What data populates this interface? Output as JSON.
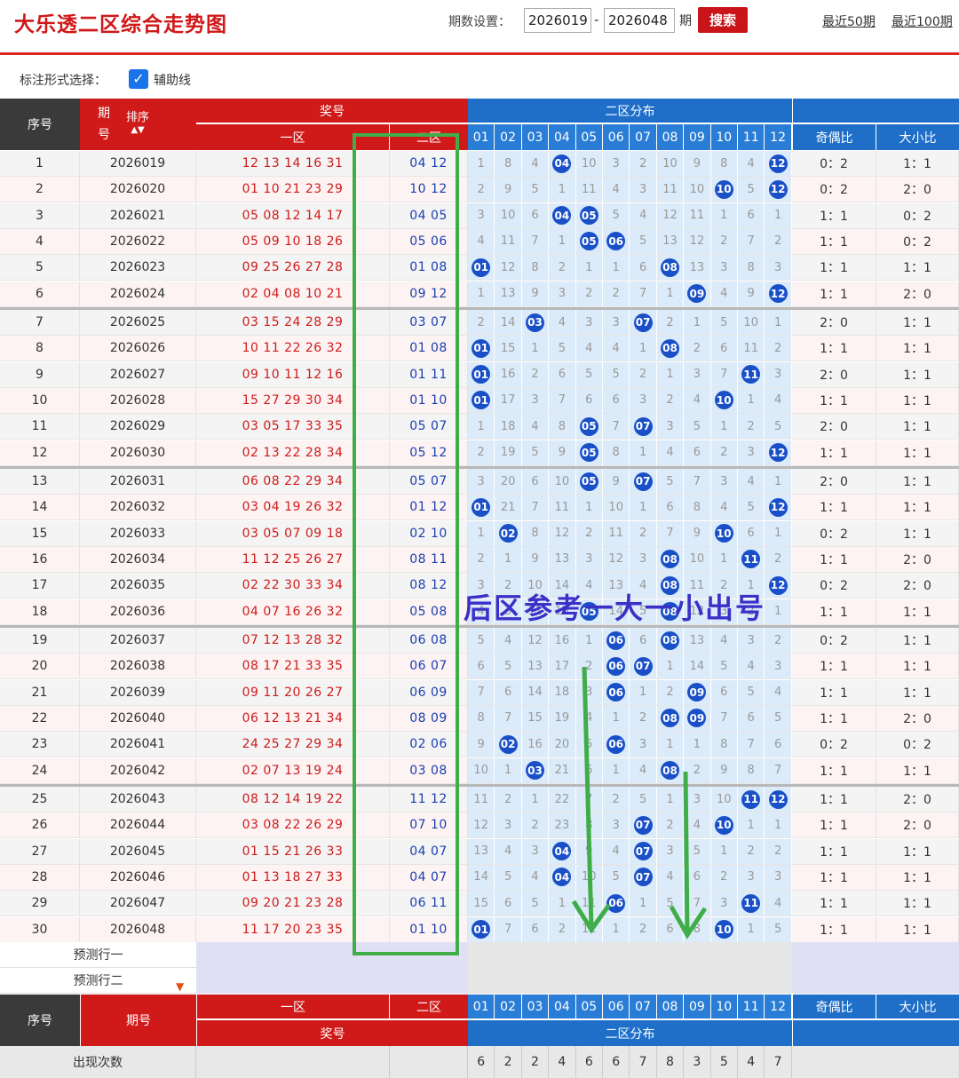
{
  "header": {
    "title": "大乐透二区综合走势图",
    "period_label": "期数设置：",
    "start_period": "2026019",
    "end_period": "2026048",
    "dash": "-",
    "period_unit": "期",
    "search_label": "搜索",
    "recent50": "最近50期",
    "recent100": "最近100期"
  },
  "options": {
    "label": "标注形式选择：",
    "aux_line_label": "辅助线",
    "aux_line_checked": true
  },
  "table_header": {
    "idx": "序号",
    "period_top": "期",
    "period_bottom": "号",
    "sort": "排序",
    "prize": "奖号",
    "zone1": "一区",
    "zone2": "二区",
    "dist": "二区分布",
    "odd_even": "奇偶比",
    "big_small": "大小比",
    "numbers": [
      "01",
      "02",
      "03",
      "04",
      "05",
      "06",
      "07",
      "08",
      "09",
      "10",
      "11",
      "12"
    ]
  },
  "rows": [
    {
      "idx": "1",
      "period": "2026019",
      "z1": "12 13 14 16 31",
      "z2": "04 12",
      "d": [
        "1",
        "8",
        "4",
        "04",
        "10",
        "3",
        "2",
        "10",
        "9",
        "8",
        "4",
        "12"
      ],
      "oe": "0：2",
      "bs": "1：1"
    },
    {
      "idx": "2",
      "period": "2026020",
      "z1": "01 10 21 23 29",
      "z2": "10 12",
      "d": [
        "2",
        "9",
        "5",
        "1",
        "11",
        "4",
        "3",
        "11",
        "10",
        "10",
        "5",
        "12"
      ],
      "oe": "0：2",
      "bs": "2：0"
    },
    {
      "idx": "3",
      "period": "2026021",
      "z1": "05 08 12 14 17",
      "z2": "04 05",
      "d": [
        "3",
        "10",
        "6",
        "04",
        "05",
        "5",
        "4",
        "12",
        "11",
        "1",
        "6",
        "1"
      ],
      "oe": "1：1",
      "bs": "0：2"
    },
    {
      "idx": "4",
      "period": "2026022",
      "z1": "05 09 10 18 26",
      "z2": "05 06",
      "d": [
        "4",
        "11",
        "7",
        "1",
        "05",
        "06",
        "5",
        "13",
        "12",
        "2",
        "7",
        "2"
      ],
      "oe": "1：1",
      "bs": "0：2"
    },
    {
      "idx": "5",
      "period": "2026023",
      "z1": "09 25 26 27 28",
      "z2": "01 08",
      "d": [
        "01",
        "12",
        "8",
        "2",
        "1",
        "1",
        "6",
        "08",
        "13",
        "3",
        "8",
        "3"
      ],
      "oe": "1：1",
      "bs": "1：1"
    },
    {
      "idx": "6",
      "period": "2026024",
      "z1": "02 04 08 10 21",
      "z2": "09 12",
      "d": [
        "1",
        "13",
        "9",
        "3",
        "2",
        "2",
        "7",
        "1",
        "09",
        "4",
        "9",
        "12"
      ],
      "oe": "1：1",
      "bs": "2：0"
    },
    {
      "idx": "7",
      "period": "2026025",
      "z1": "03 15 24 28 29",
      "z2": "03 07",
      "d": [
        "2",
        "14",
        "03",
        "4",
        "3",
        "3",
        "07",
        "2",
        "1",
        "5",
        "10",
        "1"
      ],
      "oe": "2：0",
      "bs": "1：1"
    },
    {
      "idx": "8",
      "period": "2026026",
      "z1": "10 11 22 26 32",
      "z2": "01 08",
      "d": [
        "01",
        "15",
        "1",
        "5",
        "4",
        "4",
        "1",
        "08",
        "2",
        "6",
        "11",
        "2"
      ],
      "oe": "1：1",
      "bs": "1：1"
    },
    {
      "idx": "9",
      "period": "2026027",
      "z1": "09 10 11 12 16",
      "z2": "01 11",
      "d": [
        "01",
        "16",
        "2",
        "6",
        "5",
        "5",
        "2",
        "1",
        "3",
        "7",
        "11",
        "3"
      ],
      "oe": "2：0",
      "bs": "1：1"
    },
    {
      "idx": "10",
      "period": "2026028",
      "z1": "15 27 29 30 34",
      "z2": "01 10",
      "d": [
        "01",
        "17",
        "3",
        "7",
        "6",
        "6",
        "3",
        "2",
        "4",
        "10",
        "1",
        "4"
      ],
      "oe": "1：1",
      "bs": "1：1"
    },
    {
      "idx": "11",
      "period": "2026029",
      "z1": "03 05 17 33 35",
      "z2": "05 07",
      "d": [
        "1",
        "18",
        "4",
        "8",
        "05",
        "7",
        "07",
        "3",
        "5",
        "1",
        "2",
        "5"
      ],
      "oe": "2：0",
      "bs": "1：1"
    },
    {
      "idx": "12",
      "period": "2026030",
      "z1": "02 13 22 28 34",
      "z2": "05 12",
      "d": [
        "2",
        "19",
        "5",
        "9",
        "05",
        "8",
        "1",
        "4",
        "6",
        "2",
        "3",
        "12"
      ],
      "oe": "1：1",
      "bs": "1：1"
    },
    {
      "idx": "13",
      "period": "2026031",
      "z1": "06 08 22 29 34",
      "z2": "05 07",
      "d": [
        "3",
        "20",
        "6",
        "10",
        "05",
        "9",
        "07",
        "5",
        "7",
        "3",
        "4",
        "1"
      ],
      "oe": "2：0",
      "bs": "1：1"
    },
    {
      "idx": "14",
      "period": "2026032",
      "z1": "03 04 19 26 32",
      "z2": "01 12",
      "d": [
        "01",
        "21",
        "7",
        "11",
        "1",
        "10",
        "1",
        "6",
        "8",
        "4",
        "5",
        "12"
      ],
      "oe": "1：1",
      "bs": "1：1"
    },
    {
      "idx": "15",
      "period": "2026033",
      "z1": "03 05 07 09 18",
      "z2": "02 10",
      "d": [
        "1",
        "02",
        "8",
        "12",
        "2",
        "11",
        "2",
        "7",
        "9",
        "10",
        "6",
        "1"
      ],
      "oe": "0：2",
      "bs": "1：1"
    },
    {
      "idx": "16",
      "period": "2026034",
      "z1": "11 12 25 26 27",
      "z2": "08 11",
      "d": [
        "2",
        "1",
        "9",
        "13",
        "3",
        "12",
        "3",
        "08",
        "10",
        "1",
        "11",
        "2"
      ],
      "oe": "1：1",
      "bs": "2：0"
    },
    {
      "idx": "17",
      "period": "2026035",
      "z1": "02 22 30 33 34",
      "z2": "08 12",
      "d": [
        "3",
        "2",
        "10",
        "14",
        "4",
        "13",
        "4",
        "08",
        "11",
        "2",
        "1",
        "12"
      ],
      "oe": "0：2",
      "bs": "2：0"
    },
    {
      "idx": "18",
      "period": "2026036",
      "z1": "04 07 16 26 32",
      "z2": "05 08",
      "d": [
        "4",
        "3",
        "11",
        "15",
        "05",
        "14",
        "5",
        "08",
        "12",
        "3",
        "2",
        "1"
      ],
      "oe": "1：1",
      "bs": "1：1"
    },
    {
      "idx": "19",
      "period": "2026037",
      "z1": "07 12 13 28 32",
      "z2": "06 08",
      "d": [
        "5",
        "4",
        "12",
        "16",
        "1",
        "06",
        "6",
        "08",
        "13",
        "4",
        "3",
        "2"
      ],
      "oe": "0：2",
      "bs": "1：1"
    },
    {
      "idx": "20",
      "period": "2026038",
      "z1": "08 17 21 33 35",
      "z2": "06 07",
      "d": [
        "6",
        "5",
        "13",
        "17",
        "2",
        "06",
        "07",
        "1",
        "14",
        "5",
        "4",
        "3"
      ],
      "oe": "1：1",
      "bs": "1：1"
    },
    {
      "idx": "21",
      "period": "2026039",
      "z1": "09 11 20 26 27",
      "z2": "06 09",
      "d": [
        "7",
        "6",
        "14",
        "18",
        "3",
        "06",
        "1",
        "2",
        "09",
        "6",
        "5",
        "4"
      ],
      "oe": "1：1",
      "bs": "1：1"
    },
    {
      "idx": "22",
      "period": "2026040",
      "z1": "06 12 13 21 34",
      "z2": "08 09",
      "d": [
        "8",
        "7",
        "15",
        "19",
        "4",
        "1",
        "2",
        "08",
        "09",
        "7",
        "6",
        "5"
      ],
      "oe": "1：1",
      "bs": "2：0"
    },
    {
      "idx": "23",
      "period": "2026041",
      "z1": "24 25 27 29 34",
      "z2": "02 06",
      "d": [
        "9",
        "02",
        "16",
        "20",
        "5",
        "06",
        "3",
        "1",
        "1",
        "8",
        "7",
        "6"
      ],
      "oe": "0：2",
      "bs": "0：2"
    },
    {
      "idx": "24",
      "period": "2026042",
      "z1": "02 07 13 19 24",
      "z2": "03 08",
      "d": [
        "10",
        "1",
        "03",
        "21",
        "6",
        "1",
        "4",
        "08",
        "2",
        "9",
        "8",
        "7"
      ],
      "oe": "1：1",
      "bs": "1：1"
    },
    {
      "idx": "25",
      "period": "2026043",
      "z1": "08 12 14 19 22",
      "z2": "11 12",
      "d": [
        "11",
        "2",
        "1",
        "22",
        "7",
        "2",
        "5",
        "1",
        "3",
        "10",
        "11",
        "12"
      ],
      "oe": "1：1",
      "bs": "2：0"
    },
    {
      "idx": "26",
      "period": "2026044",
      "z1": "03 08 22 26 29",
      "z2": "07 10",
      "d": [
        "12",
        "3",
        "2",
        "23",
        "8",
        "3",
        "07",
        "2",
        "4",
        "10",
        "1",
        "1"
      ],
      "oe": "1：1",
      "bs": "2：0"
    },
    {
      "idx": "27",
      "period": "2026045",
      "z1": "01 15 21 26 33",
      "z2": "04 07",
      "d": [
        "13",
        "4",
        "3",
        "04",
        "9",
        "4",
        "07",
        "3",
        "5",
        "1",
        "2",
        "2"
      ],
      "oe": "1：1",
      "bs": "1：1"
    },
    {
      "idx": "28",
      "period": "2026046",
      "z1": "01 13 18 27 33",
      "z2": "04 07",
      "d": [
        "14",
        "5",
        "4",
        "04",
        "10",
        "5",
        "07",
        "4",
        "6",
        "2",
        "3",
        "3"
      ],
      "oe": "1：1",
      "bs": "1：1"
    },
    {
      "idx": "29",
      "period": "2026047",
      "z1": "09 20 21 23 28",
      "z2": "06 11",
      "d": [
        "15",
        "6",
        "5",
        "1",
        "11",
        "06",
        "1",
        "5",
        "7",
        "3",
        "11",
        "4"
      ],
      "oe": "1：1",
      "bs": "1：1"
    },
    {
      "idx": "30",
      "period": "2026048",
      "z1": "11 17 20 23 35",
      "z2": "01 10",
      "d": [
        "01",
        "7",
        "6",
        "2",
        "12",
        "1",
        "2",
        "6",
        "8",
        "10",
        "1",
        "5"
      ],
      "oe": "1：1",
      "bs": "1：1"
    }
  ],
  "predict": {
    "row1": "预测行一",
    "row2": "预测行二"
  },
  "footer_header": {
    "idx": "序号",
    "period": "期号",
    "zone1": "一区",
    "zone2": "二区",
    "prize": "奖号",
    "dist": "二区分布",
    "odd_even": "奇偶比",
    "big_small": "大小比"
  },
  "stats": {
    "label": "出现次数",
    "counts": [
      "6",
      "2",
      "2",
      "4",
      "6",
      "6",
      "7",
      "8",
      "3",
      "5",
      "4",
      "7"
    ]
  },
  "overlay": {
    "text": "后区参考一大一小出号"
  },
  "colors": {
    "red": "#d01a1a",
    "blue_header": "#1f6fc9",
    "ball": "#1950c8",
    "green_box": "#3fae48",
    "overlay_text": "#3c2fc8"
  }
}
